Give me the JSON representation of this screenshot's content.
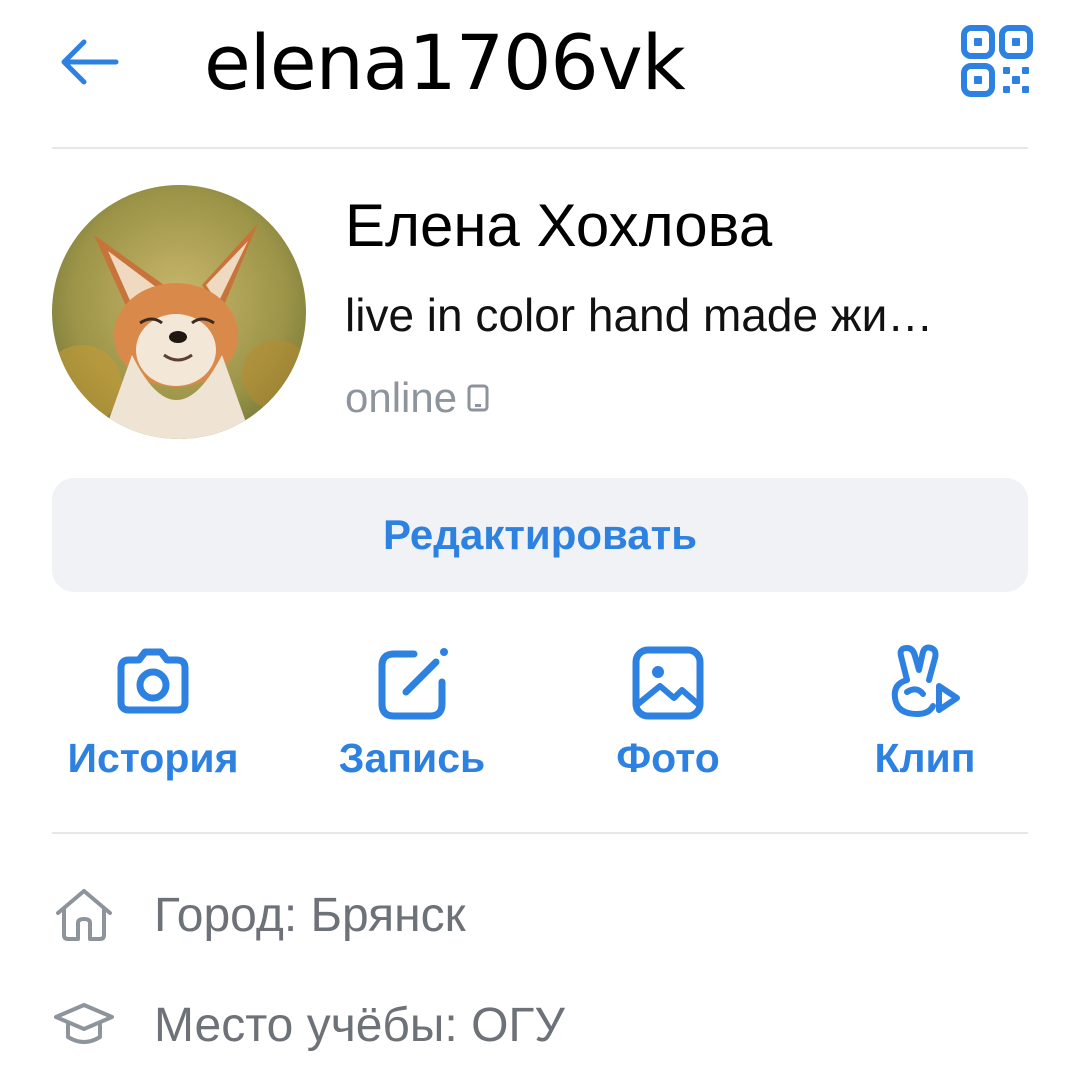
{
  "header": {
    "title": "elena1706vk",
    "back_icon": "back-arrow-icon",
    "qr_icon": "qr-code-icon"
  },
  "profile": {
    "name": "Елена Хохлова",
    "status": "live in color hand made жи…",
    "online": "online",
    "online_device_icon": "mobile-phone-icon",
    "avatar": "fox-photo"
  },
  "edit_button": {
    "label": "Редактировать"
  },
  "actions": [
    {
      "label": "История",
      "icon": "camera-icon"
    },
    {
      "label": "Запись",
      "icon": "pencil-square-icon"
    },
    {
      "label": "Фото",
      "icon": "image-icon"
    },
    {
      "label": "Клип",
      "icon": "clip-hand-icon"
    }
  ],
  "info": [
    {
      "label": "Город: Брянск",
      "icon": "home-icon"
    },
    {
      "label": "Место учёбы: ОГУ",
      "icon": "graduation-cap-icon"
    }
  ],
  "colors": {
    "accent": "#2d81e0",
    "muted_text": "#6d7178",
    "button_bg": "#f0f2f5",
    "divider": "#e6e7eb"
  }
}
